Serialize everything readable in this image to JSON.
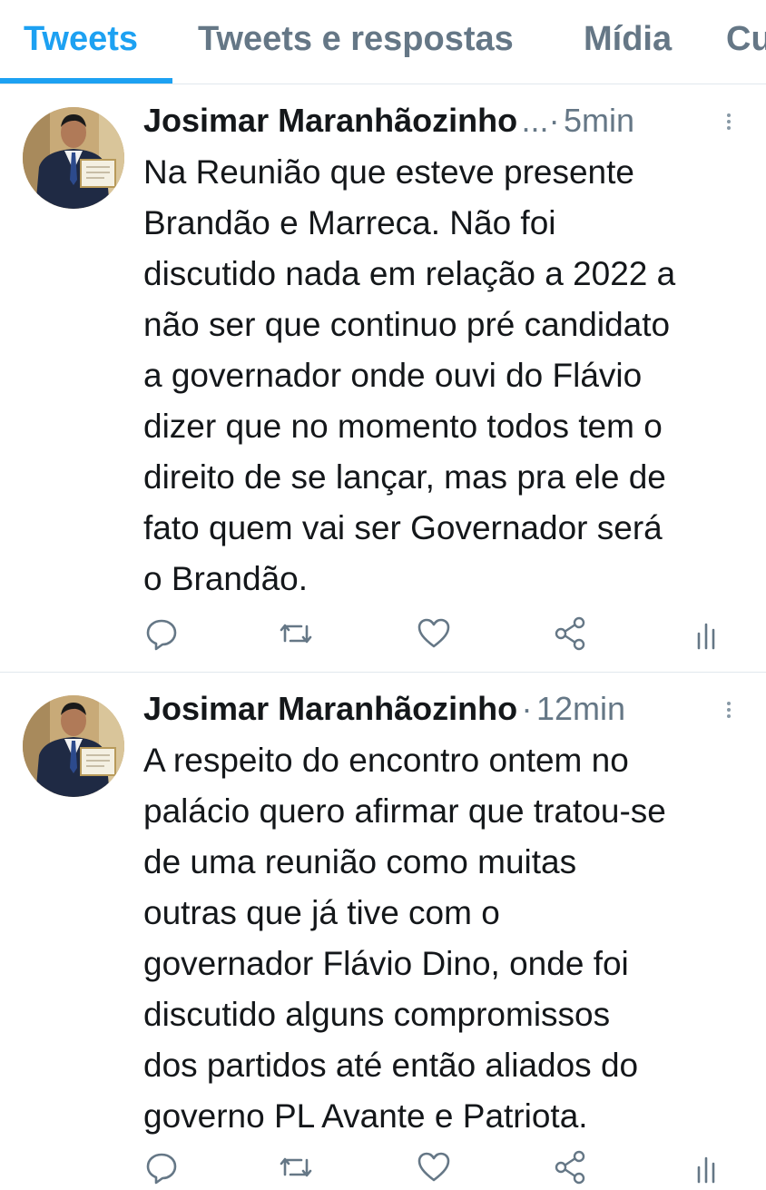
{
  "tabs": [
    "Tweets",
    "Tweets e respostas",
    "Mídia",
    "Curtidas"
  ],
  "active_tab": "Tweets",
  "accent_color": "#1da1f2",
  "tweets": [
    {
      "author": "Josimar Maranhãozinho",
      "ellipsis": "...",
      "separator": "·",
      "time": "5min",
      "text": "Na Reunião que esteve presente\nBrandão e Marreca. Não foi\ndiscutido nada em relação a 2022 a\nnão ser que continuo pré candidato\na governador onde ouvi do Flávio\ndizer que no momento todos tem o\ndireito de se lançar, mas pra ele de\nfato quem vai ser Governador será\no Brandão.",
      "actions": [
        "reply-icon",
        "retweet-icon",
        "like-icon",
        "share-icon",
        "analytics-icon"
      ]
    },
    {
      "author": "Josimar Maranhãozinho",
      "separator": "·",
      "time": "12min",
      "text": "A respeito do encontro ontem no\npalácio quero afirmar que tratou-se\nde uma reunião como muitas\noutras que já tive com o\ngovernador Flávio Dino, onde foi\ndiscutido alguns compromissos\ndos partidos até então aliados do\ngoverno PL Avante e Patriota.",
      "actions": [
        "reply-icon",
        "retweet-icon",
        "like-icon",
        "share-icon",
        "analytics-icon"
      ]
    }
  ]
}
